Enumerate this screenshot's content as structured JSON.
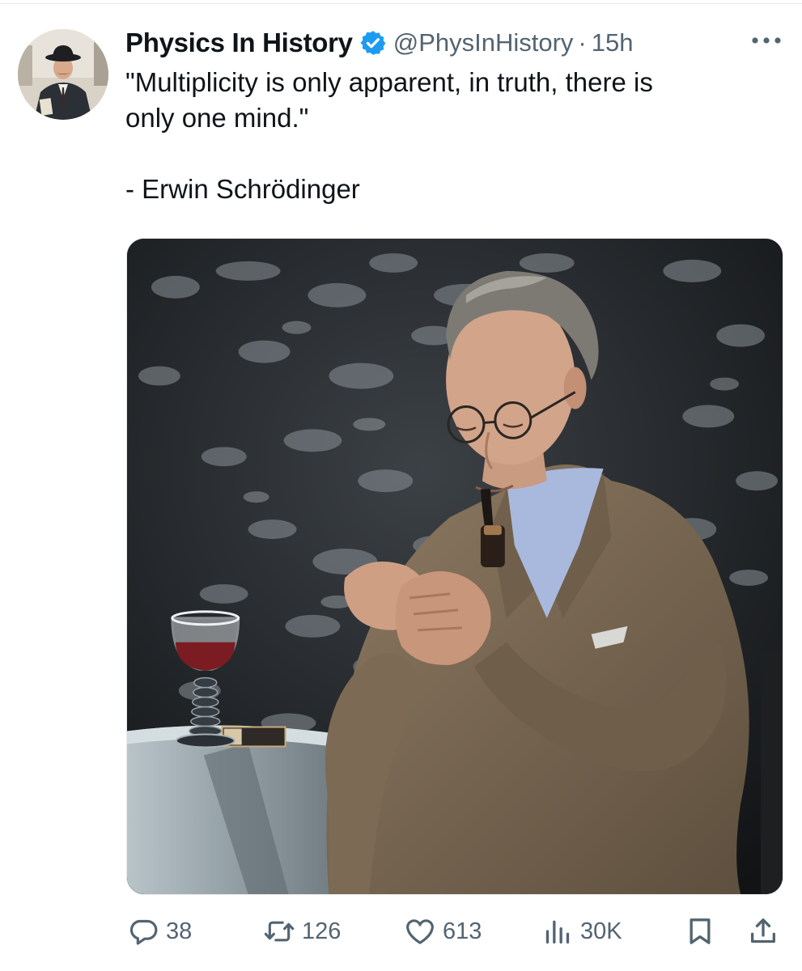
{
  "tweet": {
    "display_name": "Physics In History",
    "handle": "@PhysInHistory",
    "separator": "·",
    "timestamp": "15h",
    "text_lines": [
      "\"Multiplicity is only apparent, in truth, there is",
      "only one mind.\"",
      "- Erwin Schrödinger"
    ]
  },
  "icons": {
    "verified": "verified-badge-icon",
    "more": "more-options-icon",
    "reply": "reply-icon",
    "retweet": "retweet-icon",
    "like": "like-icon",
    "views": "views-icon",
    "bookmark": "bookmark-icon",
    "share": "share-icon"
  },
  "actions": {
    "replies": "38",
    "retweets": "126",
    "likes": "613",
    "views": "30K"
  },
  "colors": {
    "text": "#0f1419",
    "secondary": "#536471",
    "verified": "#1d9bf0"
  }
}
